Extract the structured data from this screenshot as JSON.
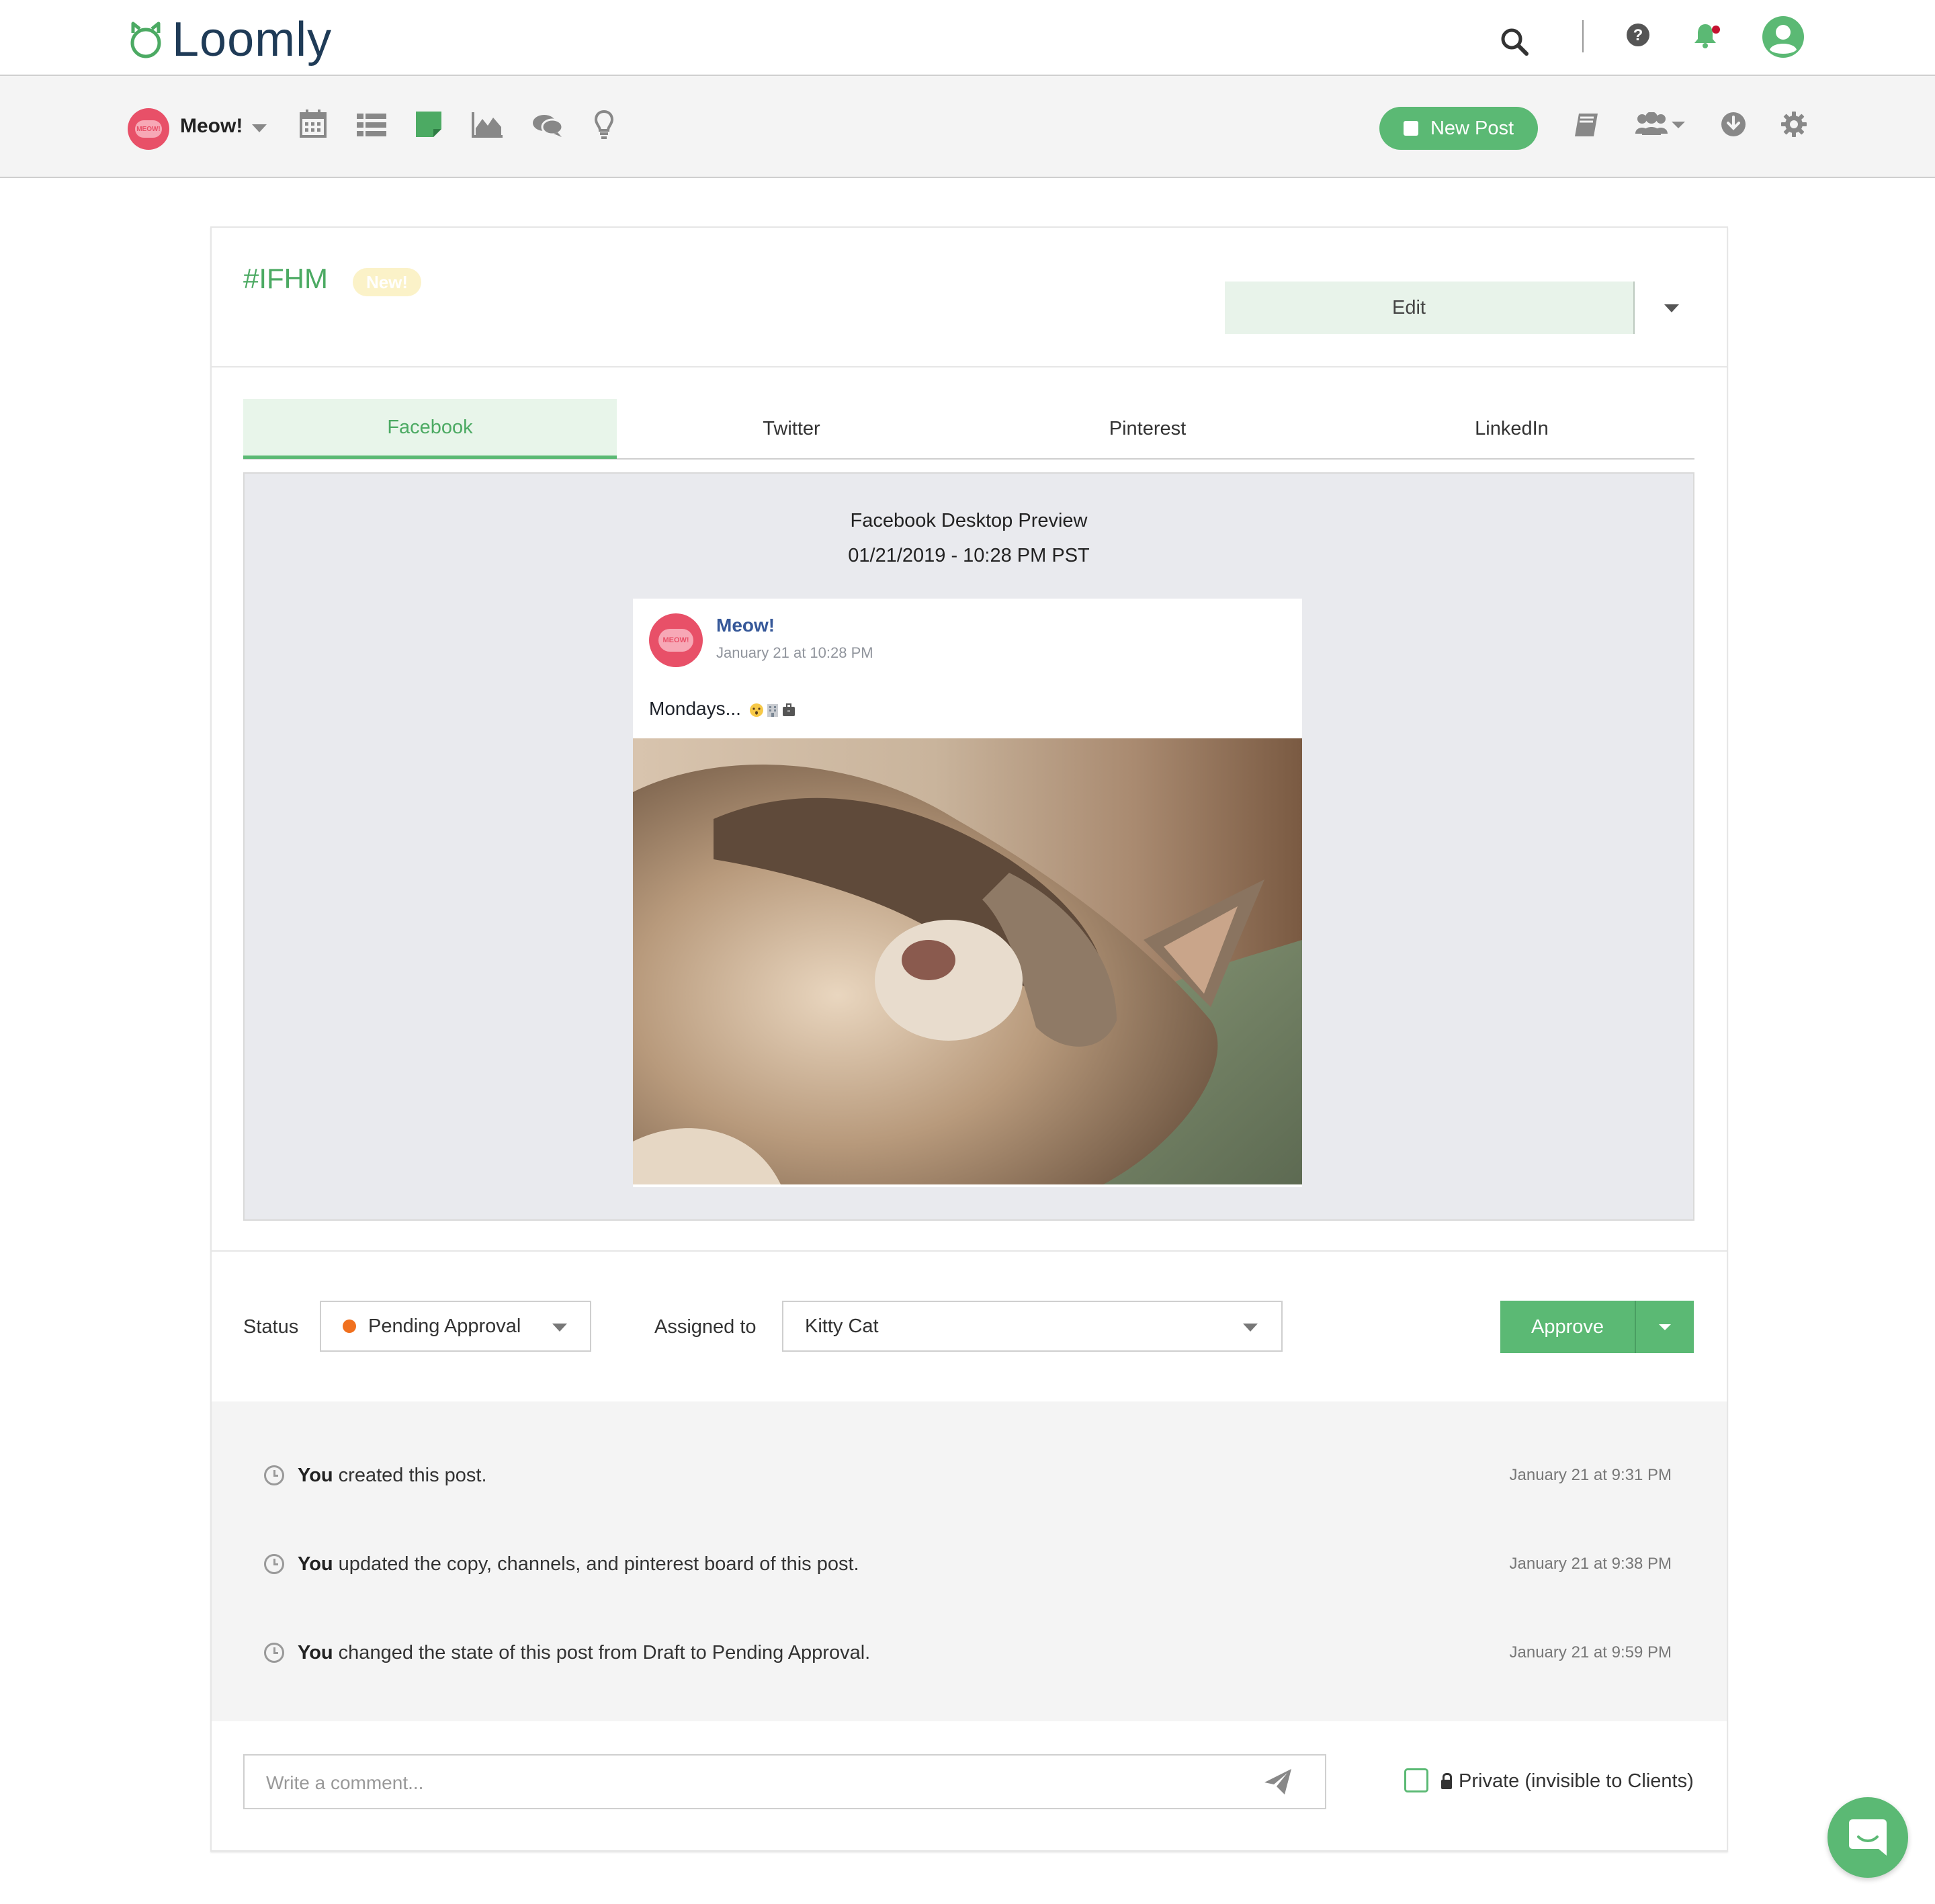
{
  "app": {
    "logo_text": "Loomly"
  },
  "subnav": {
    "brand_name": "Meow!",
    "brand_avatar_text": "MEOW!",
    "new_post_label": "New Post"
  },
  "post": {
    "title": "#IFHM",
    "badge": "New!",
    "edit_label": "Edit",
    "tabs": [
      {
        "label": "Facebook",
        "active": true
      },
      {
        "label": "Twitter",
        "active": false
      },
      {
        "label": "Pinterest",
        "active": false
      },
      {
        "label": "LinkedIn",
        "active": false
      }
    ]
  },
  "preview": {
    "title": "Facebook Desktop Preview",
    "date": "01/21/2019 - 10:28 PM PST",
    "fb_name": "Meow!",
    "fb_time": "January 21 at 10:28 PM",
    "fb_text": "Mondays..."
  },
  "workflow": {
    "status_label": "Status",
    "status_value": "Pending Approval",
    "status_color": "#f0701e",
    "assigned_label": "Assigned to",
    "assigned_value": "Kitty Cat",
    "approve_label": "Approve"
  },
  "activity": [
    {
      "actor": "You",
      "text": " created this post.",
      "time": "January 21 at 9:31 PM"
    },
    {
      "actor": "You",
      "text": " updated the copy, channels, and pinterest board of this post.",
      "time": "January 21 at 9:38 PM"
    },
    {
      "actor": "You",
      "text": " changed the state of this post from Draft to Pending Approval.",
      "time": "January 21 at 9:59 PM"
    }
  ],
  "comment": {
    "placeholder": "Write a comment...",
    "private_label": "Private (invisible to Clients)"
  },
  "colors": {
    "accent": "#5bb974",
    "brand_pink": "#e85068",
    "fb_blue": "#365899"
  }
}
